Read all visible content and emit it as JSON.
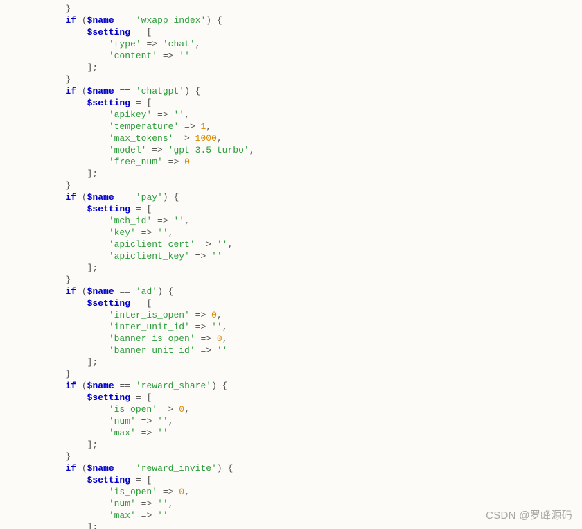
{
  "watermark": "CSDN @罗峰源码",
  "code": {
    "l1": "        }",
    "l2a": "        ",
    "l2b": "if",
    "l2c": " (",
    "l2d": "$name",
    "l2e": " == ",
    "l2f": "'wxapp_index'",
    "l2g": ") {",
    "l3a": "            ",
    "l3b": "$setting",
    "l3c": " = [",
    "l4a": "                ",
    "l4b": "'type'",
    "l4c": " => ",
    "l4d": "'chat'",
    "l4e": ",",
    "l5a": "                ",
    "l5b": "'content'",
    "l5c": " => ",
    "l5d": "''",
    "l6": "            ];",
    "l7": "        }",
    "l8a": "        ",
    "l8b": "if",
    "l8c": " (",
    "l8d": "$name",
    "l8e": " == ",
    "l8f": "'chatgpt'",
    "l8g": ") {",
    "l9a": "            ",
    "l9b": "$setting",
    "l9c": " = [",
    "l10a": "                ",
    "l10b": "'apikey'",
    "l10c": " => ",
    "l10d": "''",
    "l10e": ",",
    "l11a": "                ",
    "l11b": "'temperature'",
    "l11c": " => ",
    "l11d": "1",
    "l11e": ",",
    "l12a": "                ",
    "l12b": "'max_tokens'",
    "l12c": " => ",
    "l12d": "1000",
    "l12e": ",",
    "l13a": "                ",
    "l13b": "'model'",
    "l13c": " => ",
    "l13d": "'gpt-3.5-turbo'",
    "l13e": ",",
    "l14a": "                ",
    "l14b": "'free_num'",
    "l14c": " => ",
    "l14d": "0",
    "l15": "            ];",
    "l16": "        }",
    "l17a": "        ",
    "l17b": "if",
    "l17c": " (",
    "l17d": "$name",
    "l17e": " == ",
    "l17f": "'pay'",
    "l17g": ") {",
    "l18a": "            ",
    "l18b": "$setting",
    "l18c": " = [",
    "l19a": "                ",
    "l19b": "'mch_id'",
    "l19c": " => ",
    "l19d": "''",
    "l19e": ",",
    "l20a": "                ",
    "l20b": "'key'",
    "l20c": " => ",
    "l20d": "''",
    "l20e": ",",
    "l21a": "                ",
    "l21b": "'apiclient_cert'",
    "l21c": " => ",
    "l21d": "''",
    "l21e": ",",
    "l22a": "                ",
    "l22b": "'apiclient_key'",
    "l22c": " => ",
    "l22d": "''",
    "l23": "            ];",
    "l24": "        }",
    "l25a": "        ",
    "l25b": "if",
    "l25c": " (",
    "l25d": "$name",
    "l25e": " == ",
    "l25f": "'ad'",
    "l25g": ") {",
    "l26a": "            ",
    "l26b": "$setting",
    "l26c": " = [",
    "l27a": "                ",
    "l27b": "'inter_is_open'",
    "l27c": " => ",
    "l27d": "0",
    "l27e": ",",
    "l28a": "                ",
    "l28b": "'inter_unit_id'",
    "l28c": " => ",
    "l28d": "''",
    "l28e": ",",
    "l29a": "                ",
    "l29b": "'banner_is_open'",
    "l29c": " => ",
    "l29d": "0",
    "l29e": ",",
    "l30a": "                ",
    "l30b": "'banner_unit_id'",
    "l30c": " => ",
    "l30d": "''",
    "l31": "            ];",
    "l32": "        }",
    "l33a": "        ",
    "l33b": "if",
    "l33c": " (",
    "l33d": "$name",
    "l33e": " == ",
    "l33f": "'reward_share'",
    "l33g": ") {",
    "l34a": "            ",
    "l34b": "$setting",
    "l34c": " = [",
    "l35a": "                ",
    "l35b": "'is_open'",
    "l35c": " => ",
    "l35d": "0",
    "l35e": ",",
    "l36a": "                ",
    "l36b": "'num'",
    "l36c": " => ",
    "l36d": "''",
    "l36e": ",",
    "l37a": "                ",
    "l37b": "'max'",
    "l37c": " => ",
    "l37d": "''",
    "l38": "            ];",
    "l39": "        }",
    "l40a": "        ",
    "l40b": "if",
    "l40c": " (",
    "l40d": "$name",
    "l40e": " == ",
    "l40f": "'reward_invite'",
    "l40g": ") {",
    "l41a": "            ",
    "l41b": "$setting",
    "l41c": " = [",
    "l42a": "                ",
    "l42b": "'is_open'",
    "l42c": " => ",
    "l42d": "0",
    "l42e": ",",
    "l43a": "                ",
    "l43b": "'num'",
    "l43c": " => ",
    "l43d": "''",
    "l43e": ",",
    "l44a": "                ",
    "l44b": "'max'",
    "l44c": " => ",
    "l44d": "''",
    "l45": "            ];"
  }
}
